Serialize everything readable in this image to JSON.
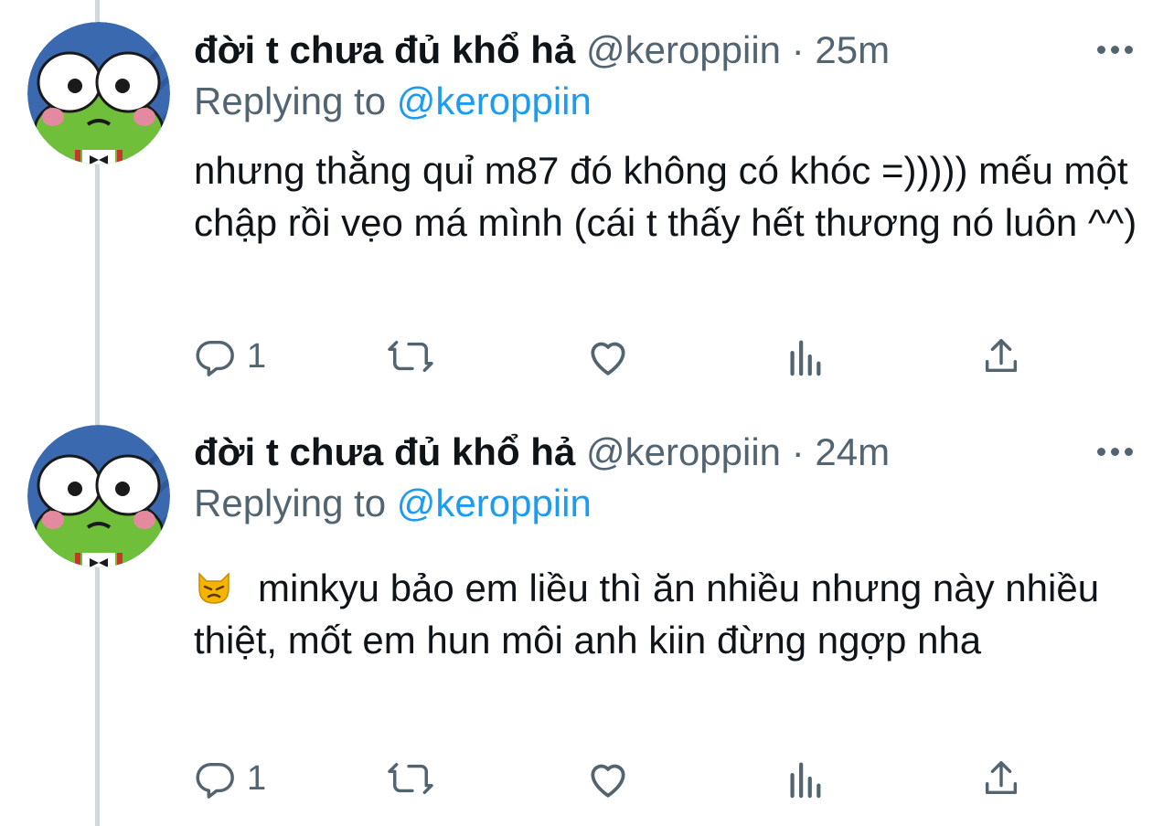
{
  "colors": {
    "name": "#0f1419",
    "secondary": "#536471",
    "mention": "#1d9bf0",
    "thread_line": "#cfd9de"
  },
  "tweets": [
    {
      "display_name": "đời t chưa đủ khổ hả",
      "handle": "@keroppiin",
      "separator": "·",
      "time": "25m",
      "replying_prefix": "Replying to",
      "replying_to": "@keroppiin",
      "text": "nhưng thằng quỉ m87 đó không có khóc =))))) mếu một chập rồi vẹo má mình (cái t thấy hết thương nó luôn ^^)",
      "reply_count": "1",
      "icons": [
        "reply-icon",
        "retweet-icon",
        "like-icon",
        "analytics-icon",
        "share-icon",
        "more-icon"
      ]
    },
    {
      "display_name": "đời t chưa đủ khổ hả",
      "handle": "@keroppiin",
      "separator": "·",
      "time": "24m",
      "replying_prefix": "Replying to",
      "replying_to": "@keroppiin",
      "emoji": "pouting-cat-emoji",
      "text": "minkyu bảo em liều thì ăn nhiều nhưng này nhiều thiệt, mốt em hun môi anh kiin đừng ngợp nha",
      "reply_count": "1",
      "icons": [
        "reply-icon",
        "retweet-icon",
        "like-icon",
        "analytics-icon",
        "share-icon",
        "more-icon"
      ]
    }
  ]
}
